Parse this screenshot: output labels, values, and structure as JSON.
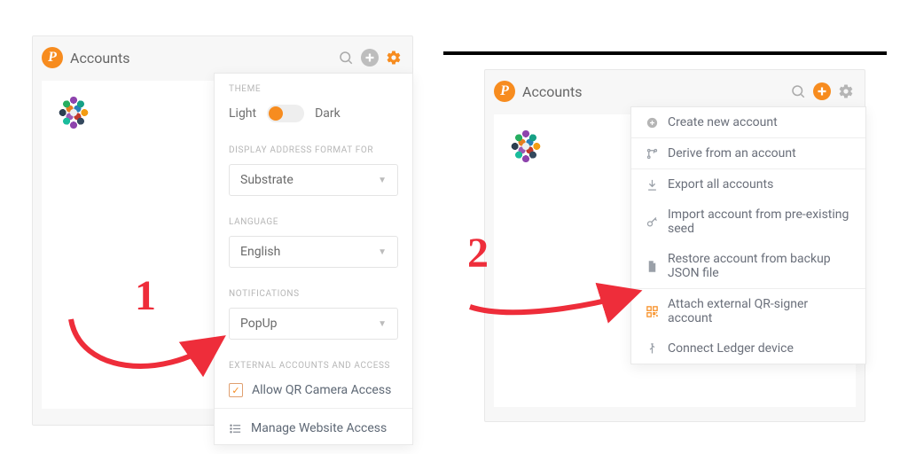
{
  "annotations": {
    "step1": "1",
    "step2": "2"
  },
  "left": {
    "title": "Accounts",
    "settings": {
      "sections": {
        "theme": {
          "label": "THEME",
          "light": "Light",
          "dark": "Dark"
        },
        "address_fmt": {
          "label": "DISPLAY ADDRESS FORMAT FOR",
          "value": "Substrate"
        },
        "language": {
          "label": "LANGUAGE",
          "value": "English"
        },
        "notifications": {
          "label": "NOTIFICATIONS",
          "value": "PopUp"
        },
        "external": {
          "label": "EXTERNAL ACCOUNTS AND ACCESS",
          "allow_qr": "Allow QR Camera Access"
        }
      },
      "manage": "Manage Website Access"
    }
  },
  "right": {
    "title": "Accounts",
    "menu": {
      "create": "Create new account",
      "derive": "Derive from an account",
      "export_all": "Export all accounts",
      "import_seed": "Import account from pre-existing seed",
      "restore_json": "Restore account from backup JSON file",
      "attach_qr": "Attach external QR-signer account",
      "connect_ledger": "Connect Ledger device"
    }
  }
}
